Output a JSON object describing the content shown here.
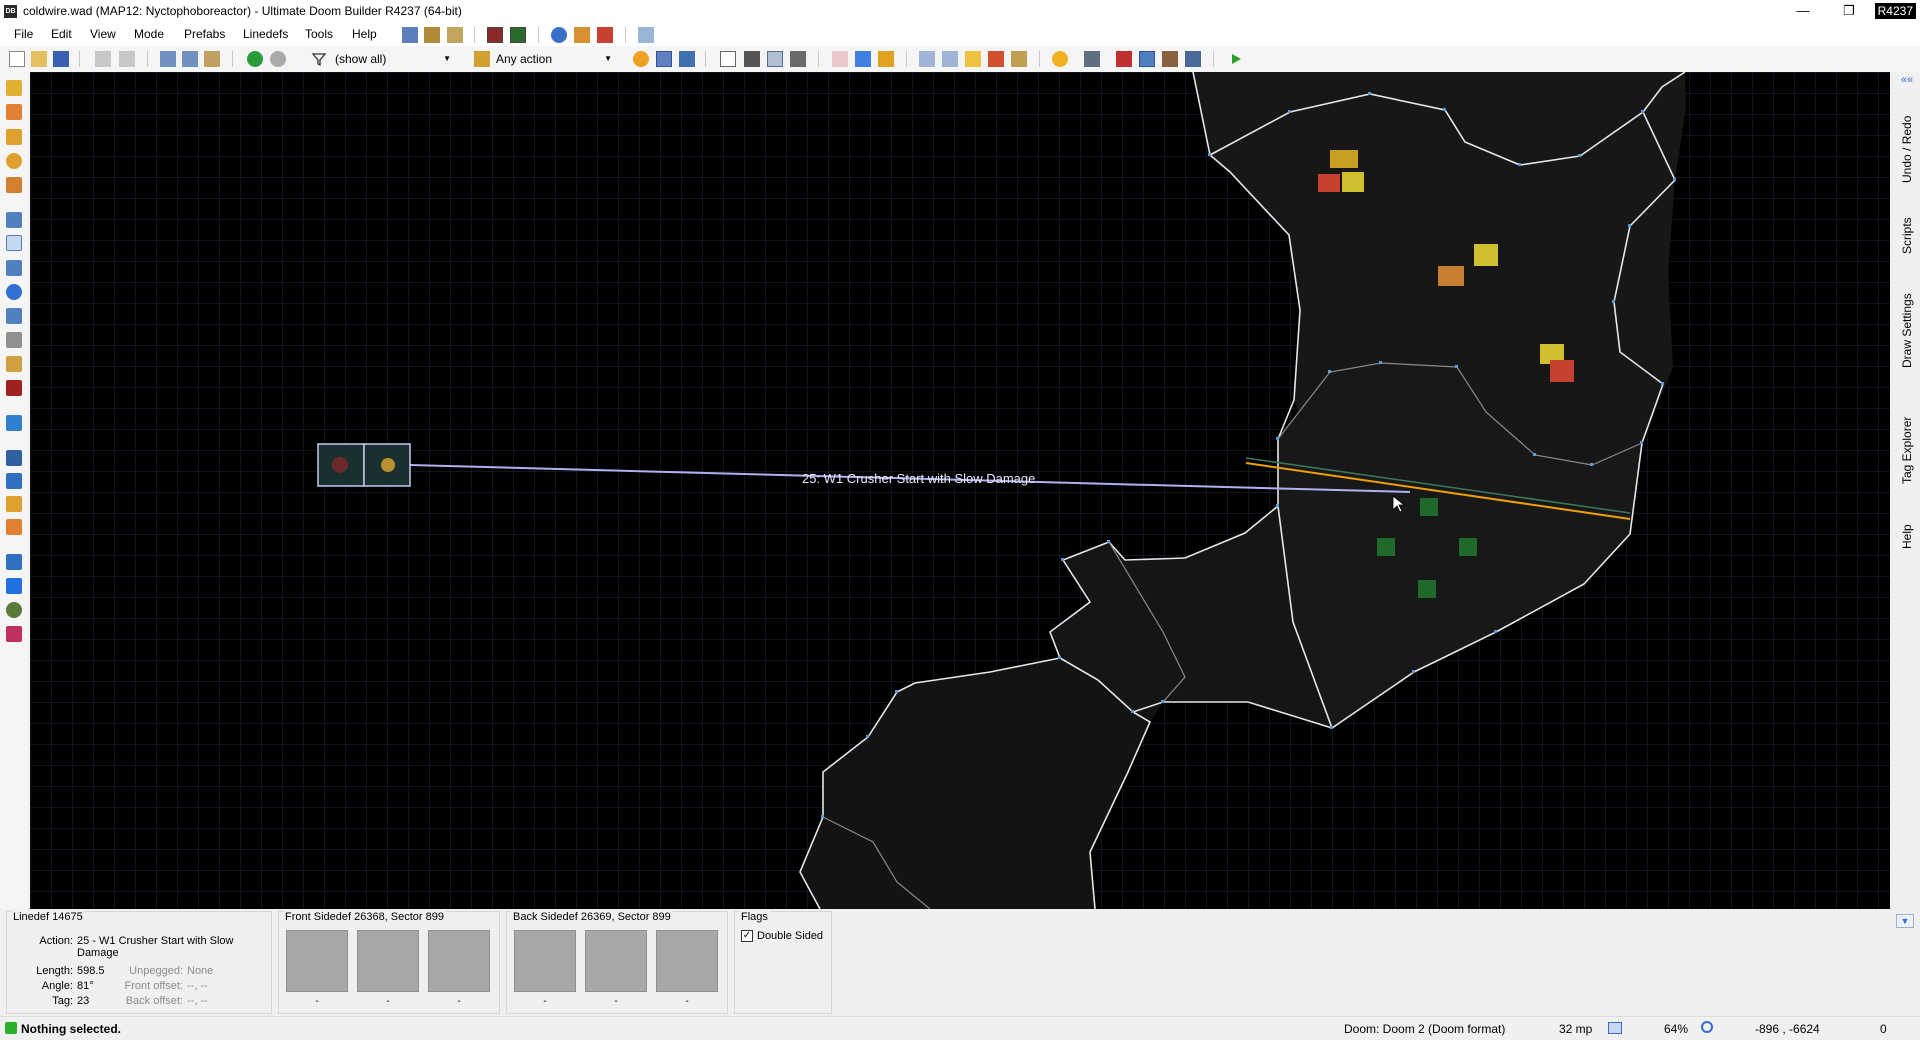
{
  "window": {
    "title": "coldwire.wad (MAP12: Nyctophoboreactor) - Ultimate Doom Builder R4237 (64-bit)",
    "app_icon": "DB",
    "revision_badge": "R4237",
    "minimize": "—",
    "restore": "❐",
    "close": "✕"
  },
  "menu": [
    "File",
    "Edit",
    "View",
    "Mode",
    "Prefabs",
    "Linedefs",
    "Tools",
    "Help"
  ],
  "toolbar": {
    "filter_value": "(show all)",
    "action_value": "Any action"
  },
  "dock_tabs": [
    "Undo / Redo",
    "Scripts",
    "Draw Settings",
    "Tag Explorer",
    "Help"
  ],
  "canvas": {
    "linedef_label": "25: W1 Crusher Start with Slow Damage"
  },
  "info": {
    "linedef_caption": "Linedef 14675",
    "action_label": "Action:",
    "action_value": "25 - W1 Crusher Start with Slow Damage",
    "length_label": "Length:",
    "length_value": "598.5",
    "angle_label": "Angle:",
    "angle_value": "81°",
    "tag_label": "Tag:",
    "tag_value": "23",
    "unpegged_label": "Unpegged:",
    "unpegged_value": "None",
    "front_offset_label": "Front offset:",
    "front_offset_value": "--, --",
    "back_offset_label": "Back offset:",
    "back_offset_value": "--, --",
    "front_sidedef_caption": "Front Sidedef 26368, Sector 899",
    "back_sidedef_caption": "Back Sidedef 26369, Sector 899",
    "texture_placeholder": "-",
    "flags_caption": "Flags",
    "double_sided_label": "Double Sided",
    "double_sided_checked": true
  },
  "status": {
    "message": "Nothing selected.",
    "game_config": "Doom: Doom 2 (Doom format)",
    "grid_size": "32 mp",
    "zoom": "64%",
    "coordinates": "-896 , -6624",
    "counter": "0"
  },
  "colors": {
    "canvas_bg": "#000000",
    "linedef": "#f0f0f0",
    "highlight": "#f0a000",
    "tag_line": "#8080d0"
  }
}
